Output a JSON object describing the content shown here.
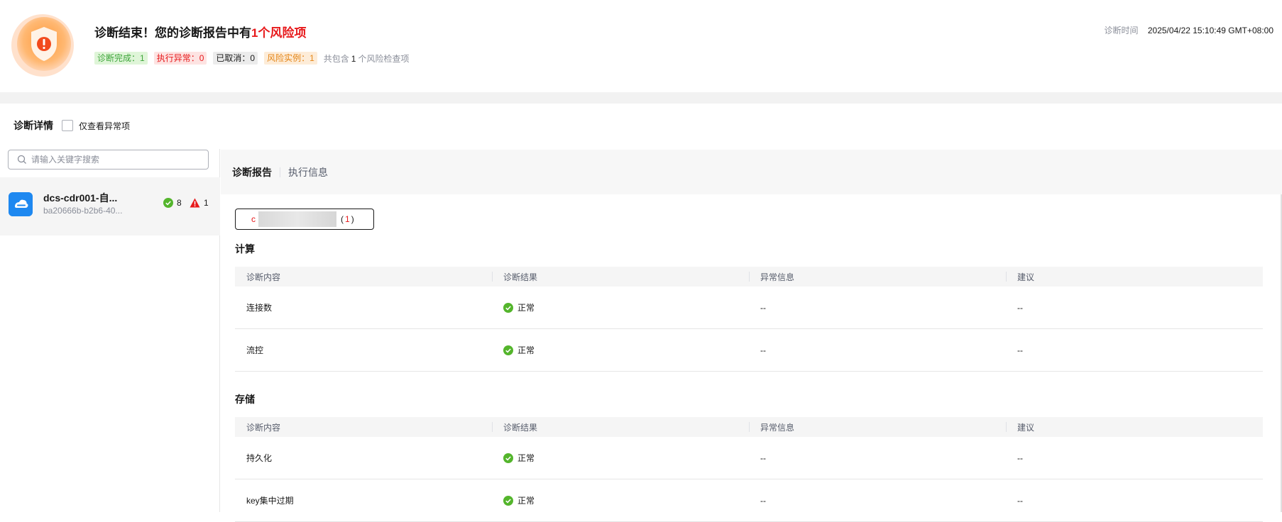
{
  "header": {
    "title_prefix": "诊断结束！您的诊断报告中有",
    "title_risk": "1个风险项",
    "tags": {
      "done": "诊断完成：1",
      "error": "执行异常：0",
      "cancelled": "已取消：0",
      "risk_instances": "风险实例：1"
    },
    "summary_prefix": "共包含",
    "summary_count": "1",
    "summary_suffix": "个风险检查项",
    "time_label": "诊断时间",
    "time_value": "2025/04/22 15:10:49 GMT+08:00"
  },
  "detail": {
    "title": "诊断详情",
    "only_abnormal_label": "仅查看异常项"
  },
  "search": {
    "placeholder": "请输入关键字搜索"
  },
  "instance": {
    "name": "dcs-cdr001-自...",
    "id": "ba20666b-b2b6-40...",
    "ok_count": "8",
    "risk_count": "1"
  },
  "tabs": {
    "report": "诊断报告",
    "exec_info": "执行信息"
  },
  "node_tab": {
    "prefix": "c",
    "open": "(",
    "count": "1",
    "close": ")"
  },
  "sections": [
    {
      "title": "计算",
      "columns": [
        "诊断内容",
        "诊断结果",
        "异常信息",
        "建议"
      ],
      "rows": [
        {
          "item": "连接数",
          "result": "正常",
          "info": "--",
          "advice": "--"
        },
        {
          "item": "流控",
          "result": "正常",
          "info": "--",
          "advice": "--"
        }
      ]
    },
    {
      "title": "存储",
      "columns": [
        "诊断内容",
        "诊断结果",
        "异常信息",
        "建议"
      ],
      "rows": [
        {
          "item": "持久化",
          "result": "正常",
          "info": "--",
          "advice": "--"
        },
        {
          "item": "key集中过期",
          "result": "正常",
          "info": "--",
          "advice": "--"
        }
      ]
    }
  ],
  "colors": {
    "risk": "#e7191b",
    "ok": "#54b52c",
    "brand": "#1e88f0",
    "warn": "#f6a21b"
  }
}
